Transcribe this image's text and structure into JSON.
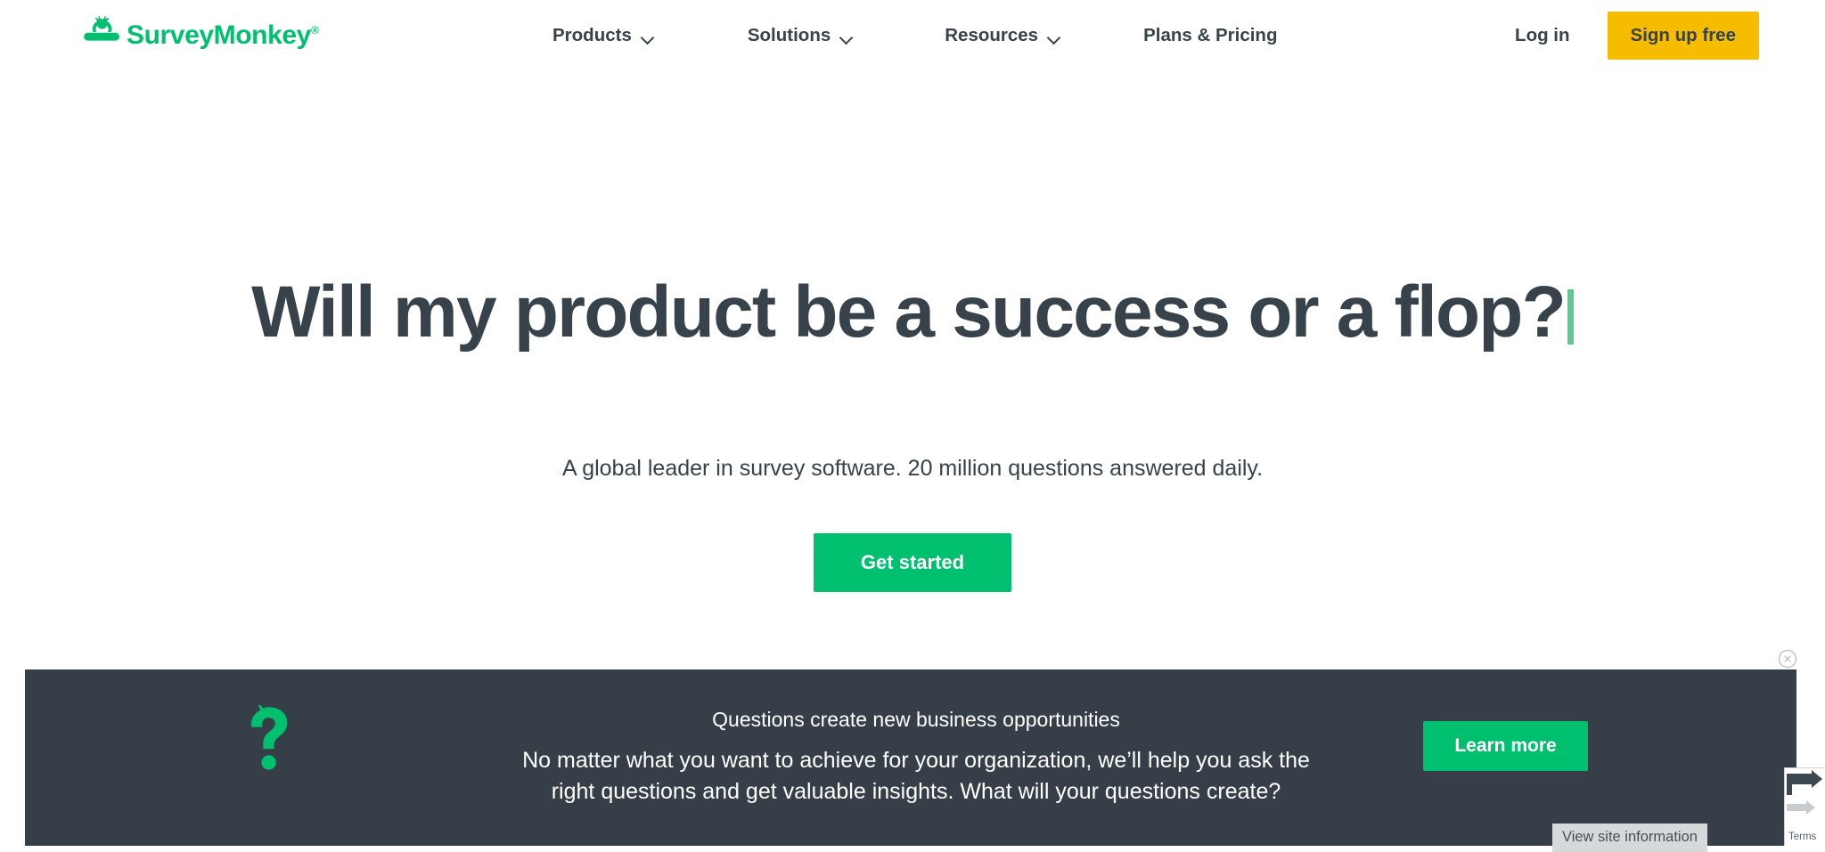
{
  "header": {
    "logo": {
      "icon": "surveymonkey-monkey-logo-icon",
      "text": "SurveyMonkey",
      "registered_mark": "®",
      "color": "#00bf6f"
    },
    "nav_items": [
      {
        "label": "Products",
        "has_dropdown": true,
        "icon": "chevron-down-icon"
      },
      {
        "label": "Solutions",
        "has_dropdown": true,
        "icon": "chevron-down-icon"
      },
      {
        "label": "Resources",
        "has_dropdown": true,
        "icon": "chevron-down-icon"
      },
      {
        "label": "Plans & Pricing",
        "has_dropdown": false,
        "icon": ""
      }
    ],
    "login_label": "Log in",
    "signup_label": "Sign up free",
    "signup_color": "#f5bc00"
  },
  "hero": {
    "title": "Will my product be a success or a flop?",
    "caret_color": "#5ccb90",
    "subtitle": "A global leader in survey software. 20 million questions answered daily.",
    "cta_label": "Get started",
    "cta_color": "#00bf6f",
    "text_color": "#37424a"
  },
  "banner": {
    "icon": "green-question-mark-icon",
    "icon_color": "#00bf6f",
    "background_color": "#363e48",
    "heading": "Questions create new business opportunities",
    "body": "No matter what you want to achieve for your organization, we’ll help you ask the right questions and get valuable insights. What will your questions create?",
    "cta_label": "Learn more",
    "cta_color": "#00bf6f",
    "close_icon": "close-circle-icon"
  },
  "browser_overlays": {
    "site_info_tooltip": "View site information",
    "recaptcha_terms": "Terms"
  }
}
